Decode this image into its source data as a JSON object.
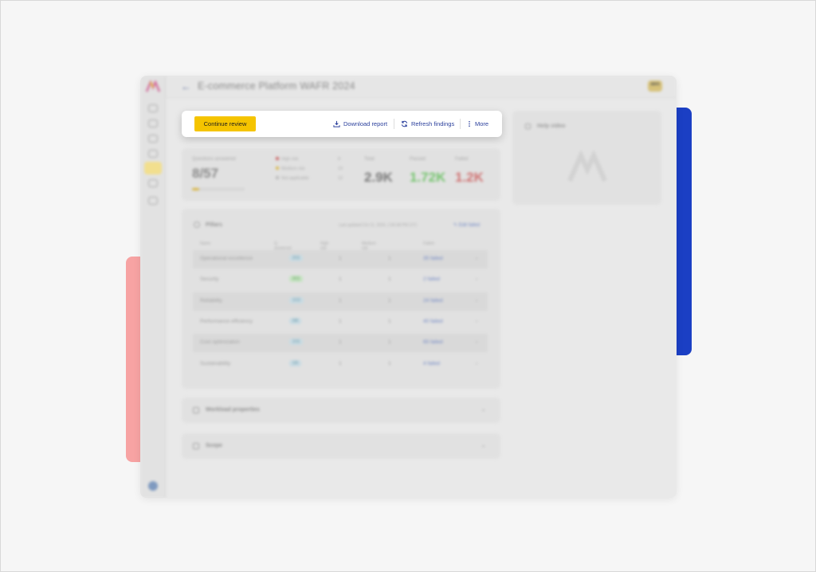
{
  "app": {
    "title": "E-commerce Platform WAFR 2024",
    "brand_badge": "aws"
  },
  "action_bar": {
    "continue_label": "Continue review",
    "download_label": "Download report",
    "refresh_label": "Refresh findings",
    "more_label": "More"
  },
  "help_panel": {
    "title": "Help video"
  },
  "stats": {
    "questions_label": "Questions answered",
    "questions_value": "8/57",
    "progress_fraction": 0.14,
    "legend": [
      {
        "label": "High risk",
        "count": "8",
        "color": "#c95b5b"
      },
      {
        "label": "Medium risk",
        "count": "13",
        "color": "#d9b543"
      },
      {
        "label": "Not applicable",
        "count": "12",
        "color": "#b5b5b5"
      }
    ],
    "total_label": "Total",
    "total_value": "2.9K",
    "passed_label": "Passed",
    "passed_value": "1.72K",
    "failed_label": "Failed",
    "failed_value": "1.2K",
    "colors": {
      "total": "#7a7a7a",
      "passed": "#74c46d",
      "failed": "#d07272"
    }
  },
  "pillars": {
    "title": "Pillars",
    "last_updated": "Last updated Oct 11, 2024, 1:56:48 PM UTC",
    "edit_failed": "Edit failed",
    "headers": {
      "name": "Name",
      "questions": "Q. answered",
      "high": "High risk",
      "medium": "Medium risk",
      "failed": "Failed"
    },
    "rows": [
      {
        "name": "Operational excellence",
        "answered": "2/11",
        "high": "1",
        "medium": "1",
        "failed": "35 failed",
        "green": false
      },
      {
        "name": "Security",
        "answered": "3/11",
        "high": "1",
        "medium": "1",
        "failed": "2 failed",
        "green": true
      },
      {
        "name": "Reliability",
        "answered": "1/13",
        "high": "1",
        "medium": "1",
        "failed": "24 failed",
        "green": false
      },
      {
        "name": "Performance efficiency",
        "answered": "0/8",
        "high": "1",
        "medium": "1",
        "failed": "40 failed",
        "green": false
      },
      {
        "name": "Cost optimization",
        "answered": "1/11",
        "high": "1",
        "medium": "1",
        "failed": "65 failed",
        "green": false
      },
      {
        "name": "Sustainability",
        "answered": "1/6",
        "high": "1",
        "medium": "1",
        "failed": "4 failed",
        "green": false
      }
    ]
  },
  "sections": {
    "workload_label": "Workload properties",
    "scope_label": "Scope"
  }
}
